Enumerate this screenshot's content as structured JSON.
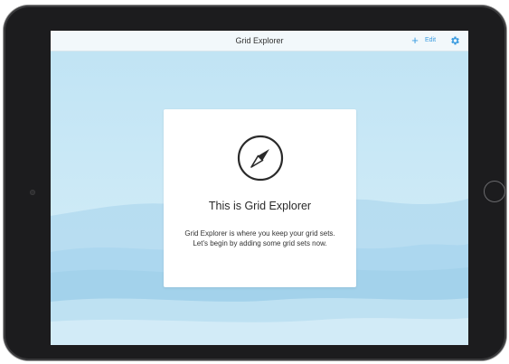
{
  "navbar": {
    "title": "Grid Explorer",
    "add_icon": "plus-icon",
    "edit_label": "Edit",
    "settings_icon": "gear-icon"
  },
  "empty_state": {
    "icon": "compass-icon",
    "title": "This is Grid Explorer",
    "body_line1": "Grid Explorer is where you keep your grid sets.",
    "body_line2": "Let's begin by adding some grid sets now."
  },
  "colors": {
    "accent": "#3a9be0",
    "background": "#c9e8f6",
    "card": "#ffffff",
    "device_frame": "#1c1c1e"
  }
}
